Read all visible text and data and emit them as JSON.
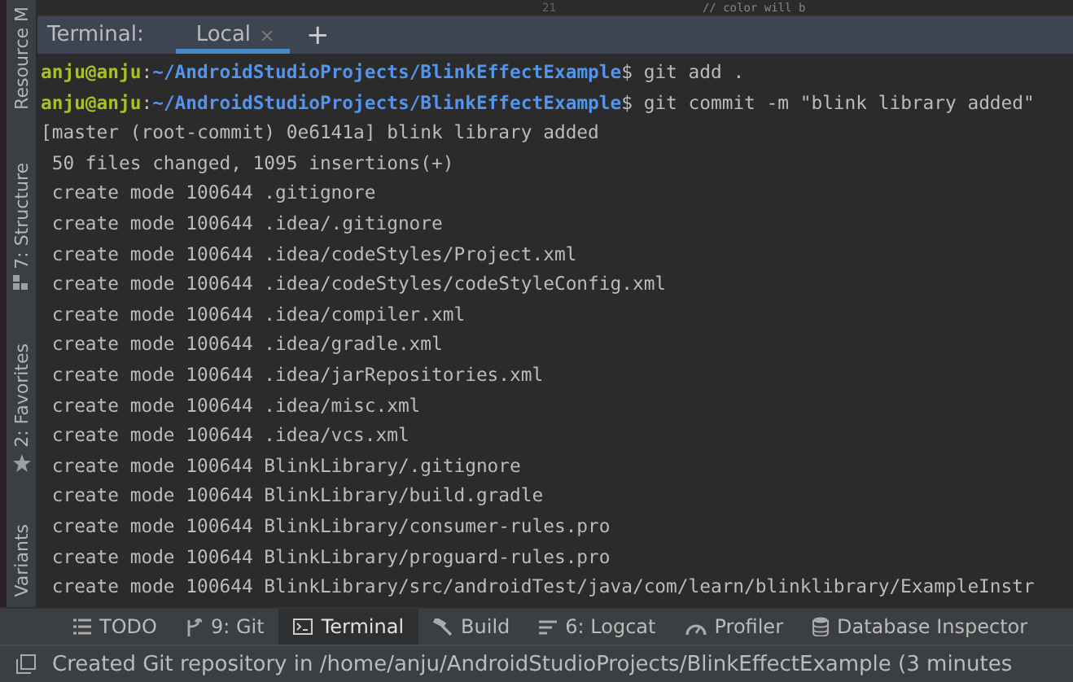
{
  "editor_strip": {
    "line_number": "21",
    "code": "// color will b"
  },
  "side_tools": [
    {
      "label": "Resource M"
    },
    {
      "label": "7: Structure"
    },
    {
      "label": "2: Favorites"
    },
    {
      "label": "Variants"
    }
  ],
  "terminal": {
    "title": "Terminal:",
    "tabs": [
      {
        "label": "Local",
        "selected": true
      }
    ],
    "add_tab": "+",
    "prompts": [
      {
        "user": "anju@anju",
        "sep": ":",
        "path": "~/AndroidStudioProjects/BlinkEffectExample",
        "command": "$ git add ."
      },
      {
        "user": "anju@anju",
        "sep": ":",
        "path": "~/AndroidStudioProjects/BlinkEffectExample",
        "command": "$ git commit -m \"blink library added\""
      }
    ],
    "output": [
      "[master (root-commit) 0e6141a] blink library added",
      " 50 files changed, 1095 insertions(+)",
      " create mode 100644 .gitignore",
      " create mode 100644 .idea/.gitignore",
      " create mode 100644 .idea/codeStyles/Project.xml",
      " create mode 100644 .idea/codeStyles/codeStyleConfig.xml",
      " create mode 100644 .idea/compiler.xml",
      " create mode 100644 .idea/gradle.xml",
      " create mode 100644 .idea/jarRepositories.xml",
      " create mode 100644 .idea/misc.xml",
      " create mode 100644 .idea/vcs.xml",
      " create mode 100644 BlinkLibrary/.gitignore",
      " create mode 100644 BlinkLibrary/build.gradle",
      " create mode 100644 BlinkLibrary/consumer-rules.pro",
      " create mode 100644 BlinkLibrary/proguard-rules.pro",
      " create mode 100644 BlinkLibrary/src/androidTest/java/com/learn/blinklibrary/ExampleInstr"
    ]
  },
  "tool_windows": [
    {
      "label": "TODO",
      "selected": false
    },
    {
      "label": "9: Git",
      "selected": false
    },
    {
      "label": "Terminal",
      "selected": true
    },
    {
      "label": "Build",
      "selected": false
    },
    {
      "label": "6: Logcat",
      "selected": false
    },
    {
      "label": "Profiler",
      "selected": false
    },
    {
      "label": "Database Inspector",
      "selected": false
    }
  ],
  "status_bar": {
    "message": "Created Git repository in /home/anju/AndroidStudioProjects/BlinkEffectExample (3 minutes"
  }
}
